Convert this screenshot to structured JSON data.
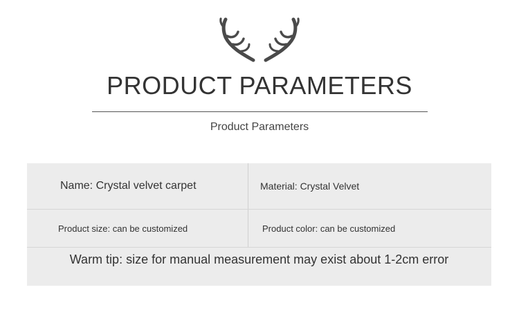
{
  "header": {
    "title": "PRODUCT PARAMETERS",
    "subtitle": "Product Parameters",
    "icon": "deer-antlers-icon"
  },
  "params": {
    "name": "Name: Crystal velvet carpet",
    "material": "Material: Crystal Velvet",
    "size": "Product size: can be customized",
    "color": "Product color: can be customized",
    "tip": "Warm tip: size for manual measurement may exist about 1-2cm error"
  },
  "colors": {
    "text": "#333333",
    "table_bg": "#ececec",
    "antler": "#4a4a4a"
  }
}
